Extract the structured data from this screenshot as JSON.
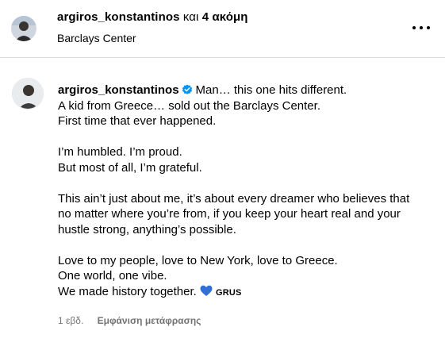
{
  "header": {
    "username": "argiros_konstantinos",
    "connector": "και",
    "others": "4 ακόμη",
    "location": "Barclays Center"
  },
  "caption": {
    "username": "argiros_konstantinos",
    "lines": [
      "Man… this one hits different.",
      "A kid from Greece… sold out the Barclays Center.",
      "First time that ever happened.",
      "",
      "I’m humbled. I’m proud.",
      "But most of all, I’m grateful.",
      "",
      "This ain’t just about me, it’s about every dreamer who believes that",
      "no matter where you’re from, if you keep your heart real and your",
      "hustle strong, anything’s possible.",
      "",
      "Love to my people, love to New York, love to Greece.",
      "One world, one vibe.",
      "We made history together."
    ],
    "flag_tag": "GRUS",
    "heart_color": "#2f6fd6"
  },
  "meta": {
    "age": "1 εβδ.",
    "translate": "Εμφάνιση μετάφρασης"
  },
  "colors": {
    "verified": "#0095f6",
    "secondary_text": "#737373",
    "divider": "#dbdbdb"
  }
}
